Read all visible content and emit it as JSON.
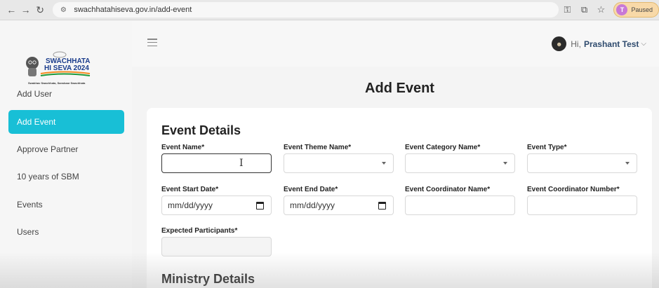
{
  "browser": {
    "url": "swachhatahiseva.gov.in/add-event",
    "paused_label": "Paused",
    "profile_initial": "T"
  },
  "logo": {
    "line1": "SWACHHATA",
    "line2": "HI SEVA 2024",
    "dates": "17th September - 2nd October 2024",
    "tagline": "Swabhav Swachhata, Sanskaar Swachhata"
  },
  "sidebar": {
    "items": [
      {
        "label": "Add User"
      },
      {
        "label": "Add Event"
      },
      {
        "label": "Approve Partner"
      },
      {
        "label": "10 years of SBM"
      },
      {
        "label": "Events"
      },
      {
        "label": "Users"
      }
    ]
  },
  "header": {
    "greeting": "Hi,",
    "user_name": "Prashant Test"
  },
  "page": {
    "title": "Add Event"
  },
  "form": {
    "event_details_title": "Event Details",
    "ministry_details_title": "Ministry Details",
    "labels": {
      "event_name": "Event Name*",
      "event_theme_name": "Event Theme Name*",
      "event_category_name": "Event Category Name*",
      "event_type": "Event Type*",
      "event_start_date": "Event Start Date*",
      "event_end_date": "Event End Date*",
      "event_coordinator_name": "Event Coordinator Name*",
      "event_coordinator_number": "Event Coordinator Number*",
      "expected_participants": "Expected Participants*"
    },
    "values": {
      "event_start_date": "mm/dd/yyyy",
      "event_end_date": "mm/dd/yyyy"
    }
  },
  "colors": {
    "accent": "#18bfd6",
    "user_name": "#2f4b6e"
  }
}
